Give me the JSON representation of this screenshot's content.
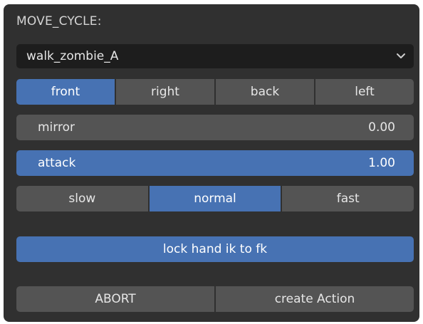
{
  "panel": {
    "title": "MOVE_CYCLE:"
  },
  "cycle_select": {
    "value": "walk_zombie_A",
    "chevron_icon": "chevron-down-icon"
  },
  "view_tabs": {
    "items": [
      {
        "label": "front",
        "active": true
      },
      {
        "label": "right",
        "active": false
      },
      {
        "label": "back",
        "active": false
      },
      {
        "label": "left",
        "active": false
      }
    ]
  },
  "mirror": {
    "label": "mirror",
    "value": "0.00"
  },
  "attack": {
    "label": "attack",
    "value": "1.00"
  },
  "speed_tabs": {
    "items": [
      {
        "label": "slow",
        "active": false
      },
      {
        "label": "normal",
        "active": true
      },
      {
        "label": "fast",
        "active": false
      }
    ]
  },
  "lock_button": {
    "label": "lock hand ik to fk"
  },
  "actions": {
    "abort_label": "ABORT",
    "create_label": "create Action"
  },
  "colors": {
    "panel_bg": "#303030",
    "control_bg": "#545454",
    "active": "#4772b3",
    "dropdown_bg": "#1d1d1d",
    "text": "#e6e6e6"
  }
}
